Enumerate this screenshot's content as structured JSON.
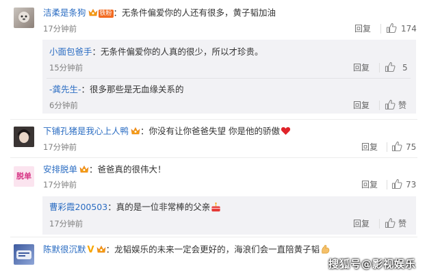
{
  "comments": [
    {
      "user": "洁柔是条狗",
      "badge": "铁粉",
      "text": "：无条件偏爱你的人还有很多，黄子韬加油",
      "time": "17分钟前",
      "reply": "回复",
      "likes": "174",
      "replies": [
        {
          "user": "小面包爸手",
          "text": "：无条件偏爱你的人真的很少，所以才珍贵。",
          "time": "15分钟前",
          "reply": "回复",
          "likes": "5"
        },
        {
          "user": "-龚先生-",
          "text": "：很多那些是无血缘关系的",
          "time": "6分钟前",
          "reply": "回复",
          "likes": "赞"
        }
      ]
    },
    {
      "user": "下铺孔猪是我心上人鸭",
      "text": "：你没有让你爸爸失望 你是他的骄傲",
      "time": "17分钟前",
      "reply": "回复",
      "likes": "75"
    },
    {
      "user": "安排脱单",
      "avatar_text": "脱单",
      "text": "：爸爸真的很伟大！",
      "time": "17分钟前",
      "reply": "回复",
      "likes": "73",
      "replies": [
        {
          "user": "曹彩霞200503",
          "text": "：真的是一位非常棒的父亲",
          "time": "17分钟前",
          "reply": "回复",
          "likes": "赞"
        }
      ]
    },
    {
      "user": "陈默很沉默",
      "text": "：龙韬娱乐的未来一定会更好的，海浪们会一直陪黄子韬"
    }
  ],
  "watermark": "搜狐号@影视娱乐",
  "colors": {
    "username": "#2a6cc2",
    "badge": "#f26b22",
    "reply_bg": "#f2f2f5"
  }
}
